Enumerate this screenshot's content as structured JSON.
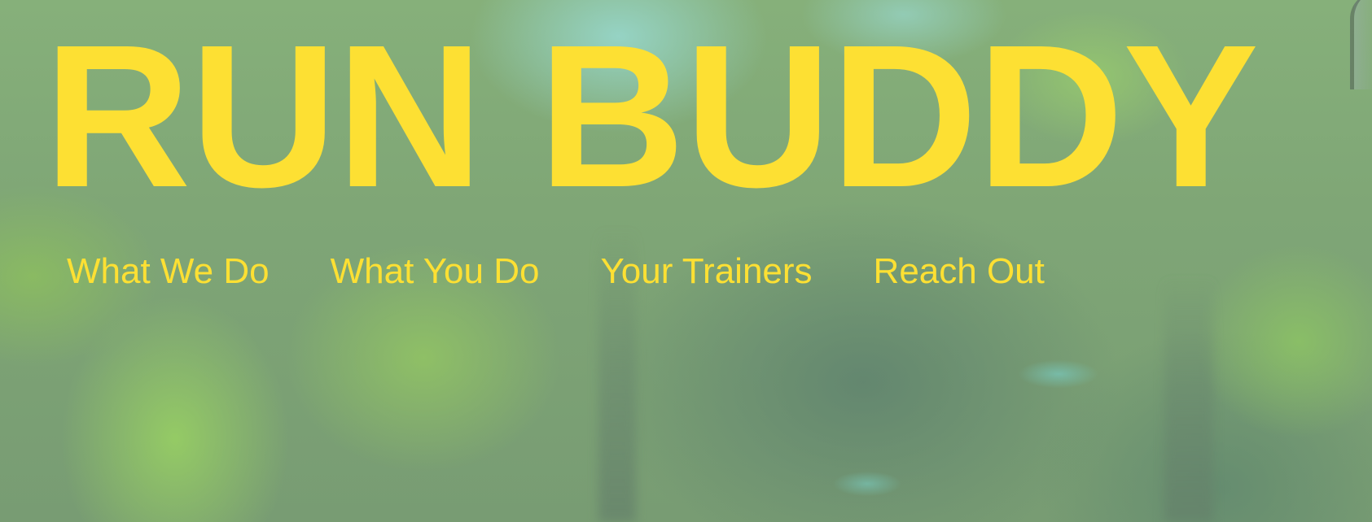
{
  "header": {
    "brand": "RUN BUDDY"
  },
  "nav": {
    "items": [
      {
        "label": "What We Do"
      },
      {
        "label": "What You Do"
      },
      {
        "label": "Your Trainers"
      },
      {
        "label": "Reach Out"
      }
    ]
  },
  "colors": {
    "accent": "#fde033",
    "background": "#7fa676"
  }
}
